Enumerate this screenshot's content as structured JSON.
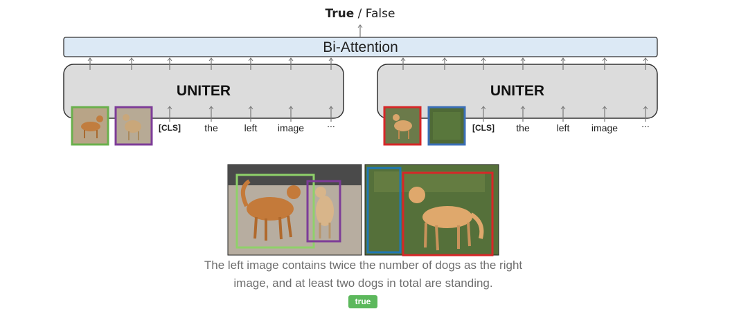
{
  "output": {
    "true_label": "True",
    "separator": " / ",
    "false_label": "False"
  },
  "bi_attention": {
    "label": "Bi-Attention"
  },
  "encoders": [
    {
      "label": "UNITER",
      "tokens": [
        "[CLS]",
        "the",
        "left",
        "image",
        "..."
      ],
      "region_colors": [
        "#6ab04c",
        "#7d3c98"
      ]
    },
    {
      "label": "UNITER",
      "tokens": [
        "[CLS]",
        "the",
        "left",
        "image",
        "..."
      ],
      "region_colors": [
        "#d62728",
        "#3b6fb6"
      ]
    }
  ],
  "example": {
    "caption_line1": "The left image contains twice the number of dogs as the right",
    "caption_line2": "image, and at least two dogs in total are standing.",
    "answer": "true",
    "left_image_boxes": [
      "#8fd16a",
      "#7d3c98"
    ],
    "right_image_boxes": [
      "#1f77b4",
      "#d62728"
    ]
  },
  "colors": {
    "bi_attention_fill": "#dce9f5",
    "uniter_fill": "#dcdcdc",
    "panel_fill": "#d8d8d8",
    "badge_fill": "#5cb85c"
  }
}
